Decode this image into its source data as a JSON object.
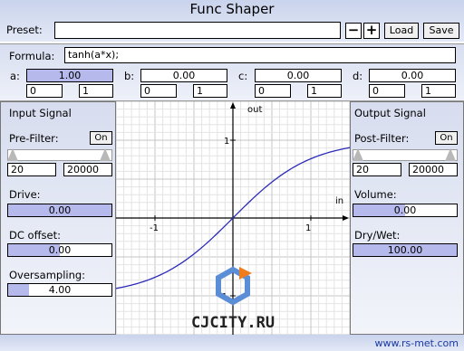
{
  "app": {
    "title": "Func Shaper",
    "url": "www.rs-met.com"
  },
  "preset": {
    "label": "Preset:",
    "value": "",
    "minus": "−",
    "plus": "+",
    "load": "Load",
    "save": "Save"
  },
  "formula": {
    "label": "Formula:",
    "value": "tanh(a*x);",
    "params": [
      {
        "name": "a:",
        "value": "1.00",
        "min": "0",
        "max": "1",
        "level": 1.0
      },
      {
        "name": "b:",
        "value": "0.00",
        "min": "0",
        "max": "1",
        "level": 0.0
      },
      {
        "name": "c:",
        "value": "0.00",
        "min": "0",
        "max": "1",
        "level": 0.0
      },
      {
        "name": "d:",
        "value": "0.00",
        "min": "0",
        "max": "1",
        "level": 0.0
      }
    ]
  },
  "input": {
    "title": "Input Signal",
    "prefilter_label": "Pre-Filter:",
    "prefilter_toggle": "On",
    "freq_low": "20",
    "freq_high": "20000",
    "drive_label": "Drive:",
    "drive_value": "0.00",
    "drive_level": 1.0,
    "dc_label": "DC offset:",
    "dc_value": "0.00",
    "dc_level": 0.5,
    "os_label": "Oversampling:",
    "os_value": "4.00",
    "os_level": 0.2
  },
  "output": {
    "title": "Output Signal",
    "postfilter_label": "Post-Filter:",
    "postfilter_toggle": "On",
    "freq_low": "20",
    "freq_high": "20000",
    "volume_label": "Volume:",
    "volume_value": "0.00",
    "volume_level": 0.5,
    "drywet_label": "Dry/Wet:",
    "drywet_value": "100.00",
    "drywet_level": 1.0
  },
  "chart_data": {
    "type": "line",
    "title": "",
    "xlabel": "in",
    "ylabel": "out",
    "xlim": [
      -1.5,
      1.5
    ],
    "ylim": [
      -1.5,
      1.5
    ],
    "grid": true,
    "xticks": [
      "-1",
      "1"
    ],
    "yticks": [
      "1",
      "-1"
    ],
    "curve": "tanh(a*x)",
    "a": 1.0,
    "color": "#2b2bb8",
    "x": [
      -1.5,
      -1.25,
      -1.0,
      -0.75,
      -0.5,
      -0.25,
      0,
      0.25,
      0.5,
      0.75,
      1.0,
      1.25,
      1.5
    ],
    "y": [
      -0.905,
      -0.848,
      -0.762,
      -0.635,
      -0.462,
      -0.245,
      0,
      0.245,
      0.462,
      0.635,
      0.762,
      0.848,
      0.905
    ]
  },
  "watermark": "CJCITY.RU",
  "colors": {
    "panel": "#d8def0",
    "slider_fill": "#b6b9ec",
    "curve": "#2b2bb8",
    "url": "#1a3aa8"
  }
}
